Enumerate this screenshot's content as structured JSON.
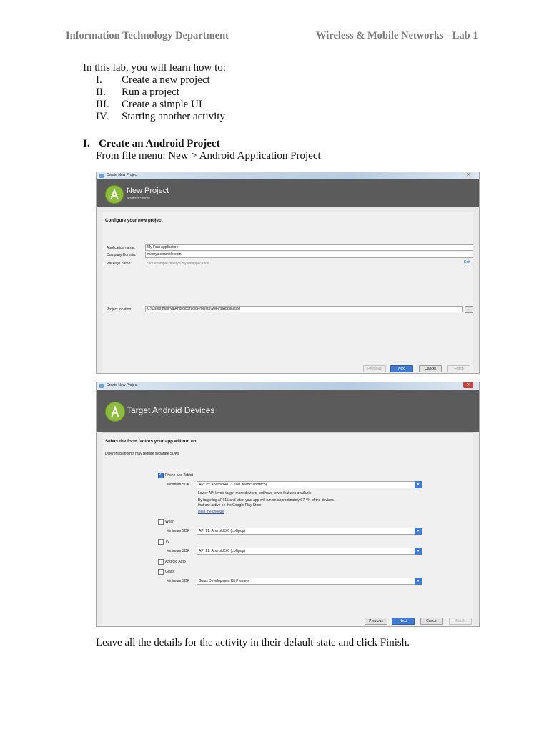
{
  "header": {
    "left": "Information Technology Department",
    "right": "Wireless & Mobile Networks - Lab 1"
  },
  "intro": "In this lab, you will learn how to:",
  "toc": [
    {
      "num": "I.",
      "text": "Create a new project"
    },
    {
      "num": "II.",
      "text": "Run a project"
    },
    {
      "num": "III.",
      "text": "Create a simple UI"
    },
    {
      "num": "IV.",
      "text": "Starting another activity"
    }
  ],
  "section": {
    "num": "I.",
    "title": "Create an Android Project"
  },
  "instruction": "From file menu: New > Android Application Project",
  "shot1": {
    "window_title": "Create New Project",
    "close": "✕",
    "banner_title": "New Project",
    "banner_sub": "Android Studio",
    "heading": "Configure your new project",
    "app_name_label": "Application name:",
    "app_name_value": "My First Application",
    "domain_label": "Company Domain:",
    "domain_value": "masrya.example.com",
    "package_label": "Package name:",
    "package_value": "com.example.masrya.myfirstapplication",
    "edit": "Edit",
    "location_label": "Project location:",
    "location_value": "C:\\Users\\masrya\\AndroidStudioProjects\\MyFirstApplication",
    "browse": "...",
    "buttons": {
      "previous": "Previous",
      "next": "Next",
      "cancel": "Cancel",
      "finish": "Finish"
    }
  },
  "shot2": {
    "window_title": "Create New Project",
    "close": "✕",
    "banner_title": "Target Android Devices",
    "heading": "Select the form factors your app will run on",
    "note": "Different platforms may require separate SDKs",
    "phone_label": "Phone and Tablet",
    "min_sdk_label": "Minimum SDK",
    "phone_sdk": "API 15: Android 4.0.3 (IceCreamSandwich)",
    "info1": "Lower API levels target more devices, but have fewer features available.",
    "info2": "By targeting API 15 and later, your app will run on approximately 97.4% of the devices",
    "info3": "that are active on the Google Play Store.",
    "help": "Help me choose",
    "wear_label": "Wear",
    "wear_sdk": "API 21: Android 5.0 (Lollipop)",
    "tv_label": "TV",
    "tv_sdk": "API 21: Android 5.0 (Lollipop)",
    "auto_label": "Android Auto",
    "glass_label": "Glass",
    "glass_sdk": "Glass Development Kit Preview",
    "arrow": "▼",
    "buttons": {
      "previous": "Previous",
      "next": "Next",
      "cancel": "Cancel",
      "finish": "Finish"
    }
  },
  "outro": "Leave all the details for the activity in their default state and click Finish."
}
